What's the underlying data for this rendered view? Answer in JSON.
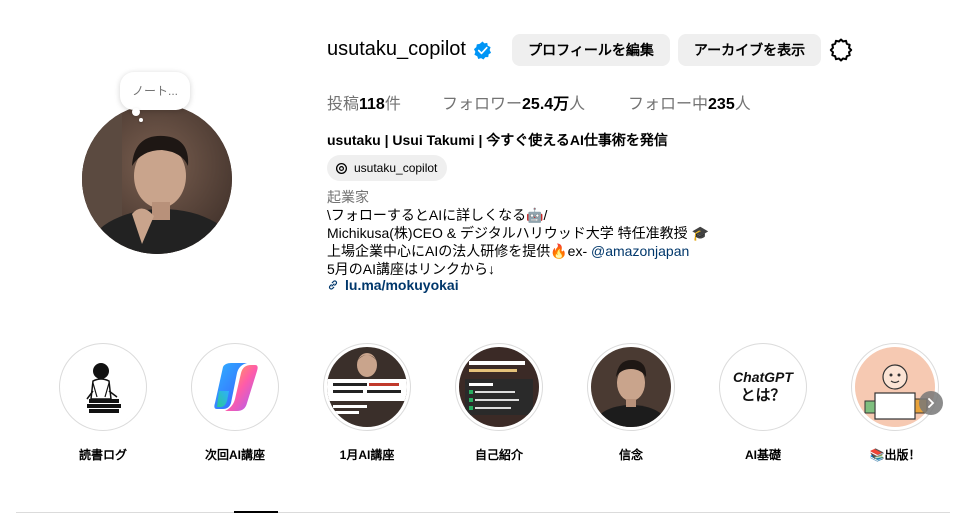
{
  "profile": {
    "username": "usutaku_copilot",
    "note": "ノート...",
    "edit_label": "プロフィールを編集",
    "archive_label": "アーカイブを表示",
    "stats": {
      "posts_label": "投稿",
      "posts_value": "118",
      "posts_unit": "件",
      "followers_label": "フォロワー",
      "followers_value": "25.4万",
      "followers_unit": "人",
      "following_label": "フォロー中",
      "following_value": "235",
      "following_unit": "人"
    },
    "full_name": "usutaku | Usui Takumi | 今すぐ使えるAI仕事術を発信",
    "threads_handle": "usutaku_copilot",
    "category": "起業家",
    "bio": {
      "line1": "\\フォローするとAIに詳しくなる🤖/",
      "line2": "Michikusa(株)CEO & デジタルハリウッド大学 特任准教授 🎓",
      "line3_prefix": "上場企業中心にAIの法人研修を提供🔥ex- ",
      "line3_mention": "@amazonjapan",
      "line4": "5月のAI講座はリンクから↓"
    },
    "link": "lu.ma/mokuyokai"
  },
  "highlights": [
    {
      "label": "読書ログ",
      "icon": "reading-illustration"
    },
    {
      "label": "次回AI講座",
      "icon": "copilot-logo"
    },
    {
      "label": "1月AI講座",
      "icon": "photo-slide"
    },
    {
      "label": "自己紹介",
      "icon": "intro-slide"
    },
    {
      "label": "信念",
      "icon": "portrait-photo"
    },
    {
      "label": "AI基礎",
      "icon": "chatgpt-text",
      "cover_line1": "ChatGPT",
      "cover_line2": "とは？"
    },
    {
      "label": "📚出版！",
      "icon": "book-illustration"
    }
  ],
  "colors": {
    "link": "#00376b",
    "verified": "#0095f6",
    "button_bg": "#efefef",
    "muted_text": "#737373"
  }
}
